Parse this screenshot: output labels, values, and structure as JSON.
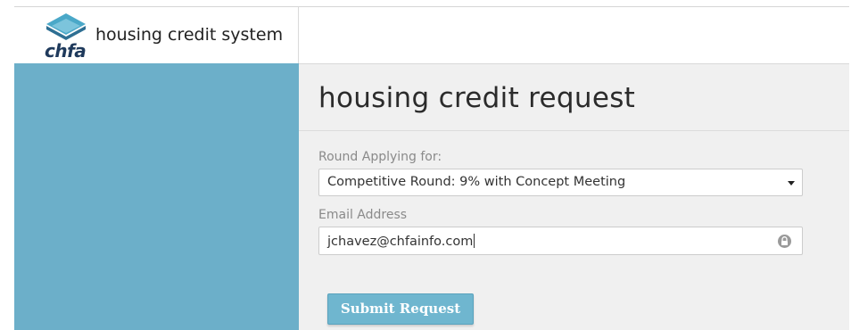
{
  "header": {
    "logo_text": "chfa",
    "app_title": "housing credit system"
  },
  "main": {
    "page_title": "housing credit request",
    "round": {
      "label": "Round Applying for:",
      "selected": "Competitive Round: 9% with Concept Meeting"
    },
    "email": {
      "label": "Email Address",
      "value": "jchavez@chfainfo.com"
    },
    "submit_label": "Submit Request"
  },
  "icons": {
    "logo": "chfa-logo-icon",
    "dropdown": "caret-down-icon",
    "field_lock": "lock-icon"
  },
  "colors": {
    "sidebar": "#6cafc9",
    "main_background": "#f0f0f0",
    "button": "#6fb6cf",
    "logo_navy": "#1f3a5c"
  }
}
